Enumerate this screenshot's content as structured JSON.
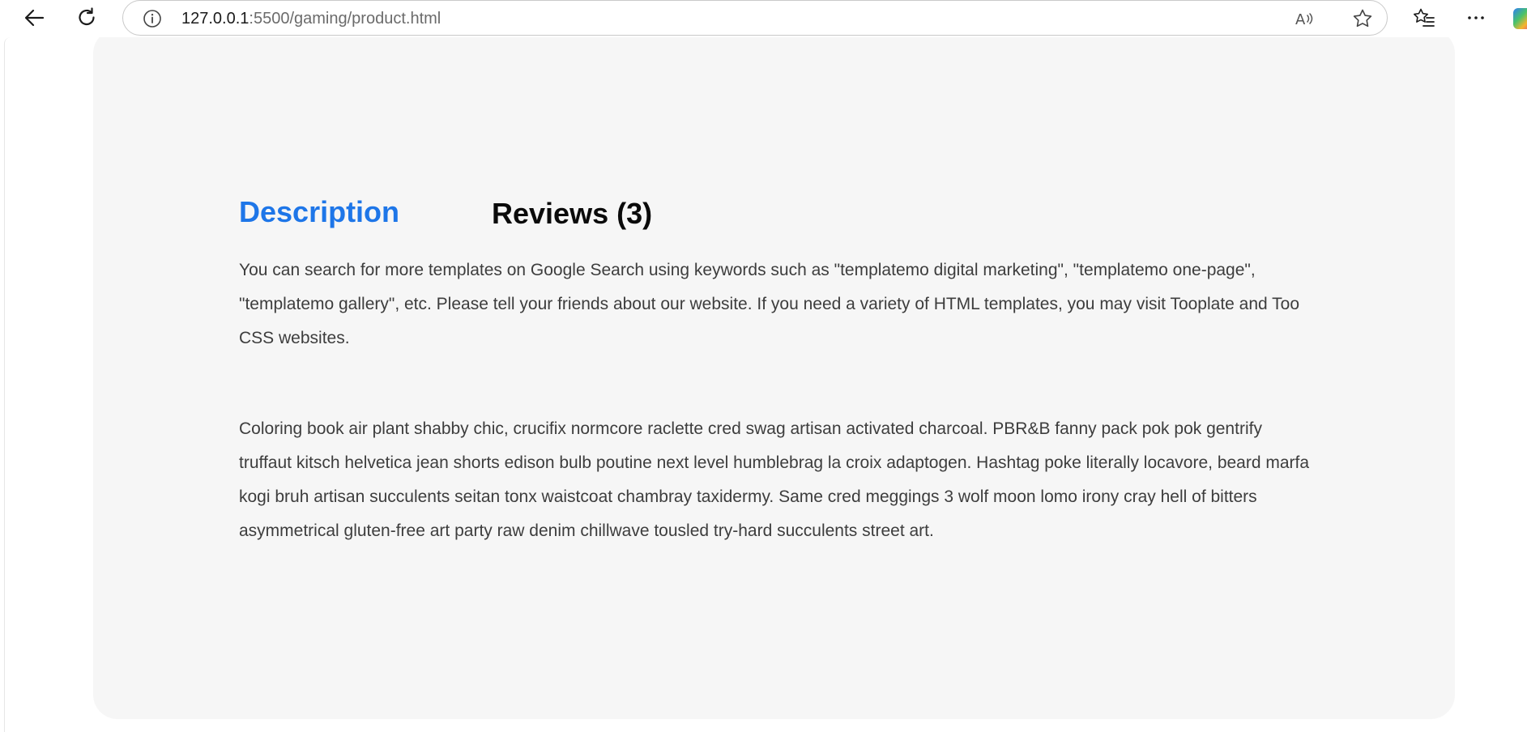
{
  "browser": {
    "url_host": "127.0.0.1",
    "url_path": ":5500/gaming/product.html",
    "icons": [
      "back-arrow-icon",
      "refresh-icon",
      "info-icon",
      "read-aloud-icon",
      "star-icon",
      "favorites-icon",
      "more-icon",
      "copilot-icon"
    ]
  },
  "tabs": {
    "description_label": "Description",
    "reviews_label": "Reviews (3)",
    "active": "description",
    "active_color": "#1e76e8"
  },
  "content": {
    "paragraph_1": "You can search for more templates on Google Search using keywords such as \"templatemo digital marketing\", \"templatemo one-page\", \"templatemo gallery\", etc. Please tell your friends about our website. If you need a variety of HTML templates, you may visit Tooplate and Too CSS websites.",
    "paragraph_2": "Coloring book air plant shabby chic, crucifix normcore raclette cred swag artisan activated charcoal. PBR&B fanny pack pok pok gentrify truffaut kitsch helvetica jean shorts edison bulb poutine next level humblebrag la croix adaptogen. Hashtag poke literally locavore, beard marfa kogi bruh artisan succulents seitan tonx waistcoat chambray taxidermy. Same cred meggings 3 wolf moon lomo irony cray hell of bitters asymmetrical gluten-free art party raw denim chillwave tousled try-hard succulents street art."
  }
}
